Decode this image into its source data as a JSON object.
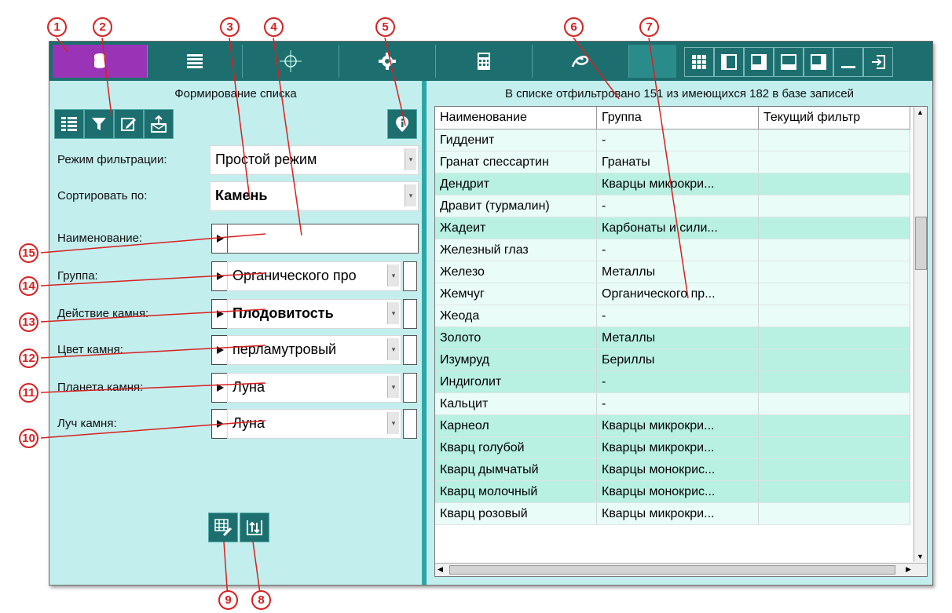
{
  "colors": {
    "toolbar": "#1d6f6f",
    "active_tab": "#9a34b7",
    "panel": "#c3eeee",
    "callout": "#d82020"
  },
  "toolbar": {
    "tabs": [
      {
        "icon": "database-icon"
      },
      {
        "icon": "list-icon"
      },
      {
        "icon": "crosshair-icon"
      },
      {
        "icon": "gear-icon"
      },
      {
        "icon": "calculator-icon"
      },
      {
        "icon": "swirl-logo-icon"
      },
      {
        "icon": "blank-tab"
      }
    ],
    "window_buttons": [
      "grid-view-icon",
      "panel-left-icon",
      "panel-bottom-left-icon",
      "panel-bottom-icon",
      "panel-right-icon",
      "minimize-icon",
      "exit-icon"
    ]
  },
  "left": {
    "title": "Формирование списка",
    "mode_label": "Режим фильтрации:",
    "mode_value": "Простой режим",
    "sort_label": "Сортировать по:",
    "sort_value": "Камень",
    "filters": [
      {
        "label": "Наименование:",
        "value": ""
      },
      {
        "label": "Группа:",
        "value": "Органического про"
      },
      {
        "label": "Действие камня:",
        "value": "Плодовитость"
      },
      {
        "label": "Цвет камня:",
        "value": "перламутровый"
      },
      {
        "label": "Планета камня:",
        "value": "Луна"
      },
      {
        "label": "Луч камня:",
        "value": "Луна"
      }
    ]
  },
  "right": {
    "status": "В списке отфильтровано 151 из имеющихся 182 в базе записей",
    "columns": [
      "Наименование",
      "Группа",
      "Текущий фильтр"
    ],
    "rows": [
      [
        "Гидденит",
        "-",
        ""
      ],
      [
        "Гранат спессартин",
        "Гранаты",
        ""
      ],
      [
        "Дендрит",
        "Кварцы микрокри...",
        ""
      ],
      [
        "Дравит (турмалин)",
        "-",
        ""
      ],
      [
        "Жадеит",
        "Карбонаты и сили...",
        ""
      ],
      [
        "Железный глаз",
        "-",
        ""
      ],
      [
        "Железо",
        "Металлы",
        ""
      ],
      [
        "Жемчуг",
        "Органического пр...",
        ""
      ],
      [
        "Жеода",
        "-",
        ""
      ],
      [
        "Золото",
        "Металлы",
        ""
      ],
      [
        "Изумруд",
        "Бериллы",
        ""
      ],
      [
        "Индиголит",
        "-",
        ""
      ],
      [
        "Кальцит",
        "-",
        ""
      ],
      [
        "Карнеол",
        "Кварцы микрокри...",
        ""
      ],
      [
        "Кварц голубой",
        "Кварцы микрокри...",
        ""
      ],
      [
        "Кварц дымчатый",
        "Кварцы монокрис...",
        ""
      ],
      [
        "Кварц молочный",
        "Кварцы монокрис...",
        ""
      ],
      [
        "Кварц розовый",
        "Кварцы микрокри...",
        ""
      ]
    ]
  },
  "callouts": [
    "1",
    "2",
    "3",
    "4",
    "5",
    "6",
    "7",
    "8",
    "9",
    "10",
    "11",
    "12",
    "13",
    "14",
    "15"
  ]
}
